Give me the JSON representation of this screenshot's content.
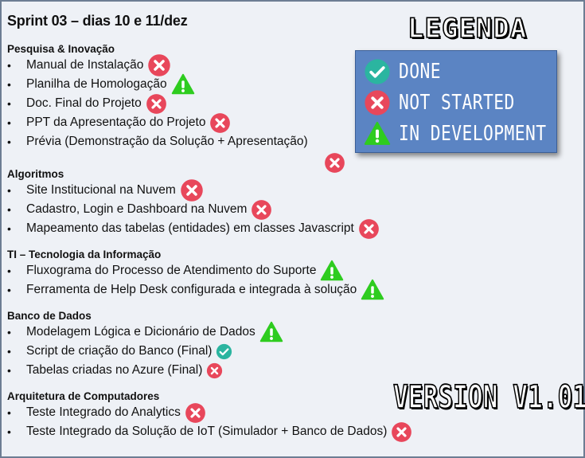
{
  "slide": {
    "title": "Sprint 03 – dias 10 e 11/dez",
    "bullet": "•",
    "sections": [
      {
        "title": "Pesquisa & Inovação",
        "items": [
          {
            "text": "Manual de Instalação",
            "status": "not-started",
            "icon_size": "large"
          },
          {
            "text": "Planilha de Homologação",
            "status": "in-development",
            "icon_size": "large"
          },
          {
            "text": "Doc. Final do Projeto",
            "status": "not-started",
            "icon_size": "medium"
          },
          {
            "text": "PPT da Apresentação do Projeto",
            "status": "not-started",
            "icon_size": "medium"
          },
          {
            "text": "Prévia  (Demonstração da Solução + Apresentação)",
            "status": "not-started",
            "icon_size": "medium",
            "icon_below": true
          }
        ]
      },
      {
        "title": "Algoritmos",
        "items": [
          {
            "text": "Site Institucional na Nuvem",
            "status": "not-started",
            "icon_size": "large"
          },
          {
            "text": "Cadastro, Login e Dashboard na Nuvem",
            "status": "not-started",
            "icon_size": "medium"
          },
          {
            "text": "Mapeamento das tabelas (entidades) em classes Javascript",
            "status": "not-started",
            "icon_size": "medium"
          }
        ]
      },
      {
        "title": "TI – Tecnologia da Informação",
        "items": [
          {
            "text": "Fluxograma do Processo de Atendimento do Suporte",
            "status": "in-development",
            "icon_size": "large"
          },
          {
            "text": "Ferramenta de Help Desk configurada e integrada à solução",
            "status": "in-development",
            "icon_size": "large"
          }
        ]
      },
      {
        "title": "Banco de Dados",
        "items": [
          {
            "text": "Modelagem Lógica e Dicionário de Dados",
            "status": "in-development",
            "icon_size": "large"
          },
          {
            "text": "Script de criação do Banco (Final)",
            "status": "done",
            "icon_size": "small"
          },
          {
            "text": "Tabelas criadas no Azure  (Final)",
            "status": "not-started",
            "icon_size": "small"
          }
        ]
      },
      {
        "title": "Arquitetura de Computadores",
        "items": [
          {
            "text": "Teste Integrado do Analytics",
            "status": "not-started",
            "icon_size": "medium"
          },
          {
            "text": "Teste Integrado da Solução de IoT (Simulador + Banco de Dados)",
            "status": "not-started",
            "icon_size": "medium"
          }
        ]
      }
    ]
  },
  "legend": {
    "title": "LEGENDA",
    "entries": [
      {
        "status": "done",
        "label": "DONE"
      },
      {
        "status": "not-started",
        "label": "NOT STARTED"
      },
      {
        "status": "in-development",
        "label": "IN DEVELOPMENT"
      }
    ]
  },
  "version": "VERSION V1.01",
  "status_icons": {
    "done": {
      "icon": "check-circle-icon",
      "color": "#2bb5a0"
    },
    "not-started": {
      "icon": "x-circle-icon",
      "color": "#e8475b"
    },
    "in-development": {
      "icon": "warning-triangle-icon",
      "color": "#2ecc1f"
    }
  }
}
